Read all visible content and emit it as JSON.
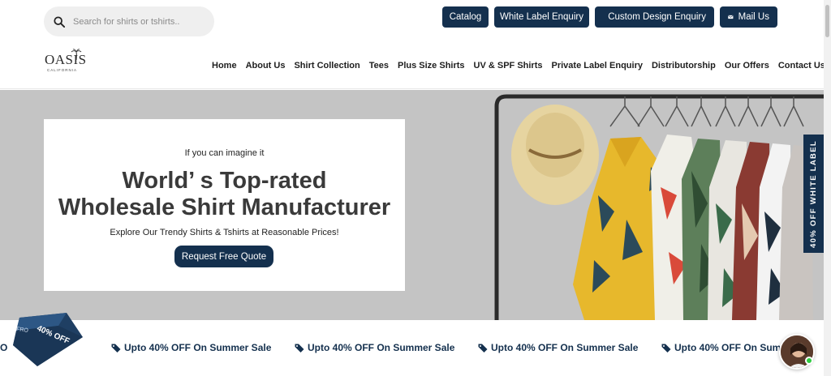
{
  "search": {
    "placeholder": "Search for shirts or tshirts.."
  },
  "top_buttons": {
    "catalog": "Catalog",
    "white_label": "White Label Enquiry",
    "custom_design": "Custom Design Enquiry",
    "mail": "Mail Us"
  },
  "logo": {
    "name": "OASIS",
    "tagline": "CALIFORNIA"
  },
  "nav": [
    "Home",
    "About Us",
    "Shirt Collection",
    "Tees",
    "Plus Size Shirts",
    "UV & SPF Shirts",
    "Private Label Enquiry",
    "Distributorship",
    "Our Offers",
    "Contact Us"
  ],
  "hero": {
    "kicker": "If you can imagine it",
    "title_line1": "World’ s Top-rated",
    "title_line2": "Wholesale Shirt Manufacturer",
    "subtitle": "Explore Our Trendy Shirts & Tshirts at Reasonable Prices!",
    "cta": "Request Free Quote"
  },
  "side_tab": "40% OFF WHITE LABEL",
  "promo_cube": {
    "text": "40% OFF",
    "small": "FRO"
  },
  "strip": {
    "items": [
      "Upto 40% OFF On Summer Sale",
      "Upto 40% OFF On Summer Sale",
      "Upto 40% OFF On Summer Sale",
      "Upto 40% OFF On Summ"
    ],
    "leading_fragment": "O"
  },
  "colors": {
    "brand_navy": "#14304e",
    "hero_bg": "#c4c4c4",
    "card_bg": "#ffffff"
  },
  "icons": {
    "search": "search-icon",
    "custom_design": "paint-brush-icon",
    "mail": "mail-icon",
    "tag": "tag-icon"
  }
}
